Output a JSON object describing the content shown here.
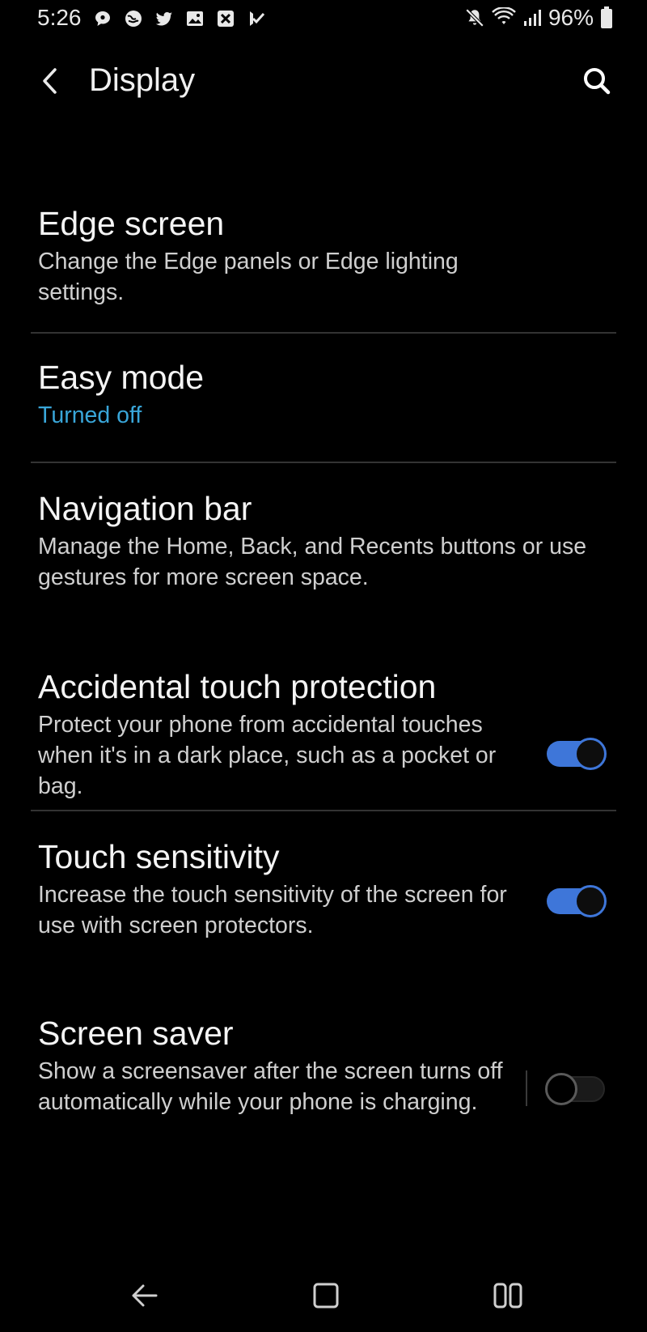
{
  "status_bar": {
    "time": "5:26",
    "battery": "96%",
    "left_icons": [
      "chat-bubble-icon",
      "globe-icon",
      "twitter-icon",
      "gallery-icon",
      "x-box-icon",
      "check-flag-icon"
    ],
    "right_icons": [
      "mute-icon",
      "wifi-icon",
      "signal-icon",
      "battery-icon"
    ]
  },
  "header": {
    "title": "Display"
  },
  "settings": {
    "edge_screen": {
      "title": "Edge screen",
      "description": "Change the Edge panels or Edge lighting settings."
    },
    "easy_mode": {
      "title": "Easy mode",
      "status": "Turned off"
    },
    "navigation_bar": {
      "title": "Navigation bar",
      "description": "Manage the Home, Back, and Recents buttons or use gestures for more screen space."
    },
    "accidental_touch": {
      "title": "Accidental touch protection",
      "description": "Protect your phone from accidental touches when it's in a dark place, such as a pocket or bag.",
      "enabled": true
    },
    "touch_sensitivity": {
      "title": "Touch sensitivity",
      "description": "Increase the touch sensitivity of the screen for use with screen protectors.",
      "enabled": true
    },
    "screen_saver": {
      "title": "Screen saver",
      "description": "Show a screensaver after the screen turns off automatically while your phone is charging.",
      "enabled": false
    }
  },
  "nav": {
    "buttons": [
      "back-icon",
      "home-icon",
      "recents-icon"
    ]
  },
  "colors": {
    "background": "#000000",
    "accent_text": "#39a6d9",
    "toggle_on": "#3e76d9",
    "divider": "#333333"
  }
}
